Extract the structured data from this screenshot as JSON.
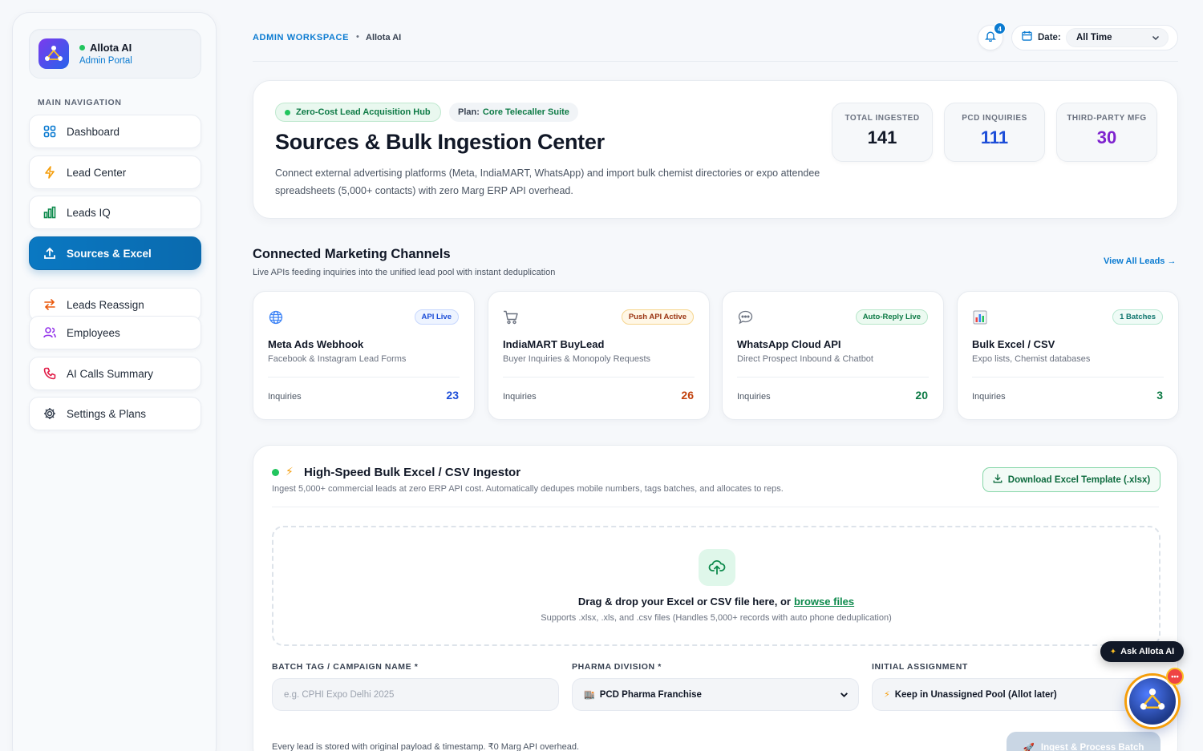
{
  "brand": {
    "name": "Allota AI",
    "subtitle": "Admin Portal"
  },
  "sidebar": {
    "heading": "MAIN NAVIGATION",
    "items": [
      {
        "label": "Dashboard",
        "icon": "grid-icon"
      },
      {
        "label": "Lead Center",
        "icon": "bolt-icon"
      },
      {
        "label": "Leads IQ",
        "icon": "bar-chart-icon"
      },
      {
        "label": "Sources & Excel",
        "icon": "upload-icon",
        "active": true
      },
      {
        "label": "Leads Reassign",
        "icon": "swap-arrows-icon"
      },
      {
        "label": "Employees",
        "icon": "users-icon"
      },
      {
        "label": "AI Calls Summary",
        "icon": "phone-icon"
      },
      {
        "label": "Settings & Plans",
        "icon": "gear-icon"
      }
    ]
  },
  "topbar": {
    "workspace": "ADMIN WORKSPACE",
    "separator": "•",
    "app": "Allota AI",
    "notification_count": "4",
    "date_label": "Date:",
    "date_value": "All Time"
  },
  "hero": {
    "hub_pill": "Zero-Cost Lead Acquisition Hub",
    "plan_label": "Plan:",
    "plan_value": "Core Telecaller Suite",
    "title": "Sources & Bulk Ingestion Center",
    "description": "Connect external advertising platforms (Meta, IndiaMART, WhatsApp) and import bulk chemist directories or expo attendee spreadsheets (5,000+ contacts) with zero Marg ERP API overhead.",
    "stats": [
      {
        "label": "TOTAL INGESTED",
        "value": "141",
        "color": "#111827"
      },
      {
        "label": "PCD INQUIRIES",
        "value": "111",
        "color": "#1d4ed8"
      },
      {
        "label": "THIRD-PARTY MFG",
        "value": "30",
        "color": "#7e22ce"
      }
    ]
  },
  "channels_section": {
    "title": "Connected Marketing Channels",
    "subtitle": "Live APIs feeding inquiries into the unified lead pool with instant deduplication",
    "view_all": "View All Leads →"
  },
  "channels": [
    {
      "name": "Meta Ads Webhook",
      "desc": "Facebook & Instagram Lead Forms",
      "badge": "API Live",
      "inq_label": "Inquiries",
      "count": "23",
      "icon": "globe-icon",
      "count_color": "#1d4ed8",
      "badge_bg": "#eef4ff",
      "badge_border": "#c7d7fe",
      "badge_color": "#1d4ed8"
    },
    {
      "name": "IndiaMART BuyLead",
      "desc": "Buyer Inquiries & Monopoly Requests",
      "badge": "Push API Active",
      "inq_label": "Inquiries",
      "count": "26",
      "icon": "cart-icon",
      "count_color": "#c2410c",
      "badge_bg": "#fff7e6",
      "badge_border": "#f6d58e",
      "badge_color": "#9a3412"
    },
    {
      "name": "WhatsApp Cloud API",
      "desc": "Direct Prospect Inbound & Chatbot",
      "badge": "Auto-Reply Live",
      "inq_label": "Inquiries",
      "count": "20",
      "icon": "chat-bubble-icon",
      "count_color": "#0d7a45",
      "badge_bg": "#ecfaf1",
      "badge_border": "#b7e6c9",
      "badge_color": "#0d7a45"
    },
    {
      "name": "Bulk Excel / CSV",
      "desc": "Expo lists, Chemist databases",
      "badge": "1 Batches",
      "inq_label": "Inquiries",
      "count": "3",
      "icon": "spreadsheet-chart-icon",
      "count_color": "#0d7a45",
      "badge_bg": "#effbf6",
      "badge_border": "#b9e8d2",
      "badge_color": "#0f766e"
    }
  ],
  "ingestor": {
    "title": "High-Speed Bulk Excel / CSV Ingestor",
    "subtitle": "Ingest 5,000+ commercial leads at zero ERP API cost. Automatically dedupes mobile numbers, tags batches, and allocates to reps.",
    "download_button": "Download Excel Template (.xlsx)",
    "dropzone_title": "Drag & drop your Excel or CSV file here, or",
    "dropzone_link": "browse files",
    "dropzone_sub": "Supports .xlsx, .xls, and .csv files (Handles 5,000+ records with auto phone deduplication)",
    "batch_label": "BATCH TAG / CAMPAIGN NAME *",
    "batch_placeholder": "e.g. CPHI Expo Delhi 2025",
    "division_label": "PHARMA DIVISION *",
    "division_value": "PCD Pharma Franchise",
    "assign_label": "INITIAL ASSIGNMENT",
    "assign_value": "Keep in Unassigned Pool (Allot later)",
    "footnote": "Every lead is stored with original payload & timestamp. ₹0 Marg API overhead.",
    "process_button": "Ingest & Process Batch"
  },
  "assistant": {
    "ask_label": "Ask Allota AI",
    "badge": "•••"
  }
}
